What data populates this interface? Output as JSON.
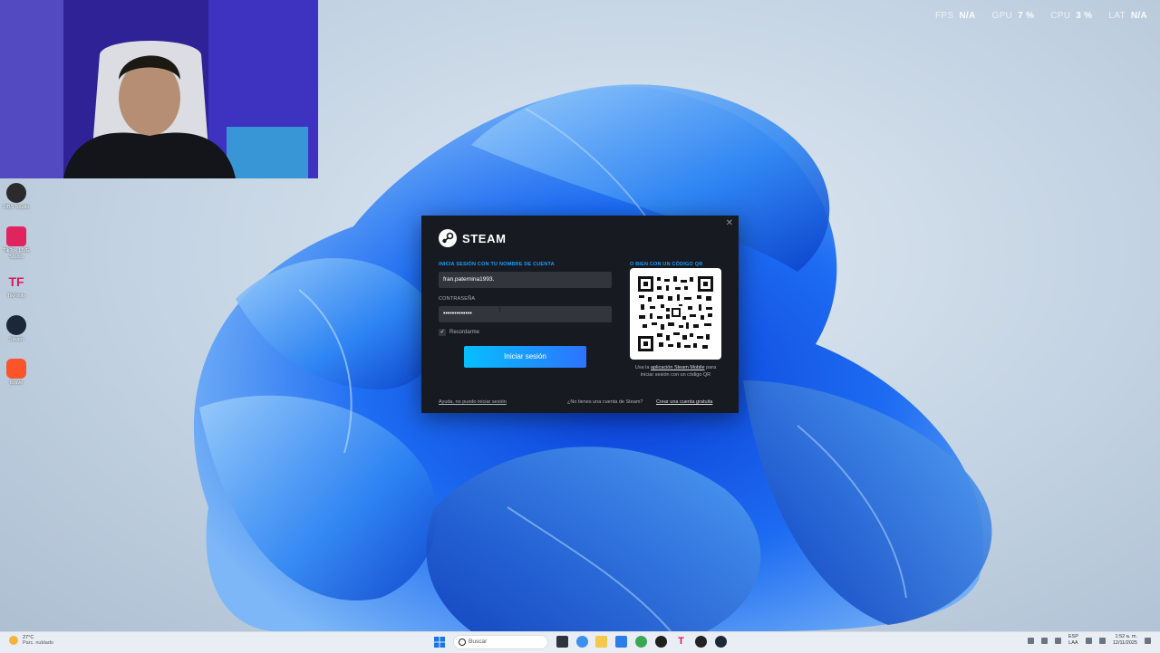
{
  "overlay": {
    "fps_label": "FPS",
    "fps_value": "N/A",
    "gpu_label": "GPU",
    "gpu_value": "7 %",
    "cpu_label": "CPU",
    "cpu_value": "3 %",
    "lat_label": "LAT",
    "lat_value": "N/A"
  },
  "desktop_icons": [
    {
      "label": "OBS Studio",
      "icon": "obs-icon",
      "color": "#2b2b2b"
    },
    {
      "label": "TikTok LIVE Studio",
      "icon": "tiktok-icon",
      "color": "#e0245e"
    },
    {
      "label": "TikFinity",
      "icon": "tikfinity-icon",
      "color": "#d81b60"
    },
    {
      "label": "Steam",
      "icon": "steam-icon",
      "color": "#1b2838"
    },
    {
      "label": "Brave",
      "icon": "brave-icon",
      "color": "#fb542b"
    }
  ],
  "steam": {
    "logo_text": "STEAM",
    "account_label": "INICIA SESIÓN CON TU NOMBRE DE CUENTA",
    "account_value": "fran.paternina1993.",
    "password_label": "CONTRASEÑA",
    "password_value": "•••••••••••••",
    "remember_label": "Recordarme",
    "remember_checked": "✓",
    "signin_button": "Iniciar sesión",
    "qr_label": "O BIEN CON UN CÓDIGO QR",
    "qr_caption_prefix": "Usa la",
    "qr_caption_link": "aplicación Steam Mobile",
    "qr_caption_suffix": "para iniciar sesión con un código QR",
    "help_link": "Ayuda, no puedo iniciar sesión",
    "no_account_text": "¿No tienes una cuenta de Steam?",
    "create_account_link": "Crear una cuenta gratuita",
    "close_glyph": "✕"
  },
  "taskbar": {
    "weather_temp": "27°C",
    "weather_desc": "Parc. nublado",
    "search_placeholder": "Buscar",
    "lang_top": "ESP",
    "lang_bottom": "LAA",
    "time": "1:52 a. m.",
    "date": "12/11/2025",
    "apps": [
      {
        "icon": "file-explorer-icon",
        "color": "#f2c94c"
      },
      {
        "icon": "store-icon",
        "color": "#2b7de9"
      },
      {
        "icon": "chrome-icon",
        "color": "#3aa757"
      },
      {
        "icon": "media-player-icon",
        "color": "#1f1f1f"
      },
      {
        "icon": "tikfinity-icon",
        "color": "#d81b60"
      },
      {
        "icon": "capcut-icon",
        "color": "#222222"
      },
      {
        "icon": "steam-icon",
        "color": "#1b2838"
      }
    ]
  }
}
